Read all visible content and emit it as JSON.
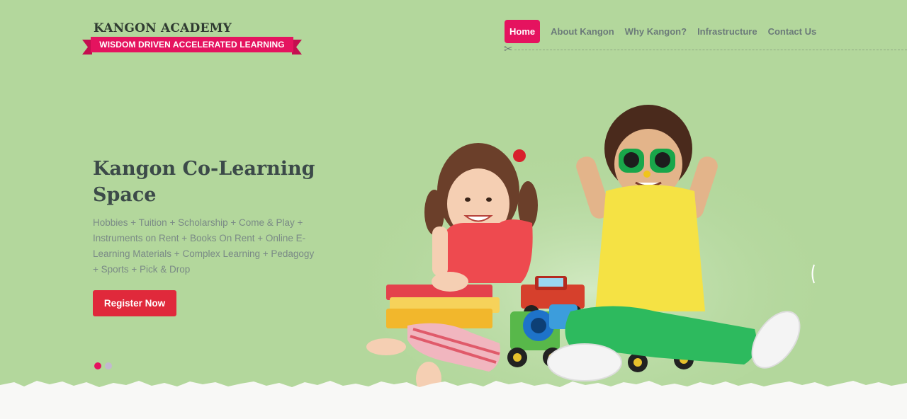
{
  "header": {
    "logo_title": "KANGON ACADEMY",
    "logo_tagline": "WISDOM DRIVEN ACCELERATED LEARNING"
  },
  "nav": {
    "items": [
      {
        "label": "Home",
        "active": true
      },
      {
        "label": "About Kangon",
        "active": false
      },
      {
        "label": "Why Kangon?",
        "active": false
      },
      {
        "label": "Infrastructure",
        "active": false
      },
      {
        "label": "Contact Us",
        "active": false
      }
    ]
  },
  "hero": {
    "title": "Kangon Co-Learning Space",
    "description": "Hobbies + Tuition + Scholarship + Come & Play + Instruments on Rent + Books On Rent + Online E-Learning Materials + Complex Learning + Pedagogy + Sports + Pick & Drop",
    "cta_label": "Register Now"
  },
  "slider": {
    "slide_count": 2,
    "active_index": 0
  },
  "icons": {
    "scissors": "scissors-icon"
  },
  "colors": {
    "background": "#b3d79c",
    "accent_pink": "#e5135f",
    "cta_red": "#e0293b",
    "nav_text": "#6b7a79",
    "title_text": "#3c4a49",
    "body_text": "#7a8a86"
  }
}
